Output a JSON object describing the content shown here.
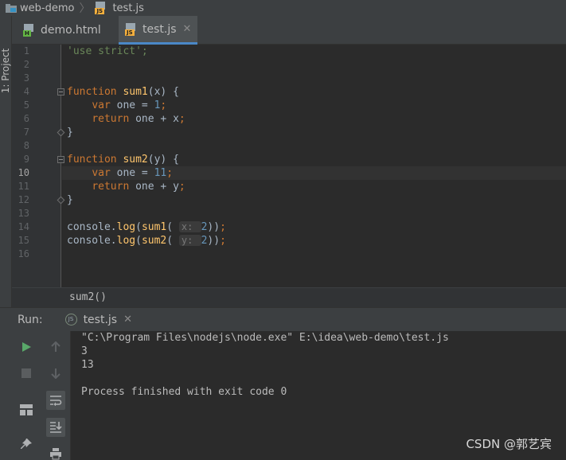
{
  "breadcrumb": {
    "project": "web-demo",
    "file": "test.js"
  },
  "left_strip": {
    "project_tab": "1: Project"
  },
  "tabs": [
    {
      "label": "demo.html",
      "badge": "H",
      "active": false
    },
    {
      "label": "test.js",
      "badge": "JS",
      "active": true
    }
  ],
  "editor": {
    "current_line": 10,
    "line_numbers": [
      "1",
      "2",
      "3",
      "4",
      "5",
      "6",
      "7",
      "8",
      "9",
      "10",
      "11",
      "12",
      "13",
      "14",
      "15",
      "16"
    ]
  },
  "code_breadcrumb": "sum2()",
  "run": {
    "label": "Run:",
    "tab_label": "test.js",
    "console": [
      "\"C:\\Program Files\\nodejs\\node.exe\" E:\\idea\\web-demo\\test.js",
      "3",
      "13",
      "",
      "Process finished with exit code 0"
    ]
  },
  "watermark": "CSDN @郭艺宾",
  "icons": {
    "run": "play-icon",
    "stop": "stop-icon",
    "up": "arrow-up-icon",
    "down": "arrow-down-icon",
    "layout": "layout-icon",
    "wrap": "soft-wrap-icon",
    "scroll": "scroll-to-end-icon",
    "pin": "pin-icon",
    "print": "print-icon"
  },
  "colors": {
    "keyword": "#cc7832",
    "string": "#6a8759",
    "number": "#6897bb",
    "function": "#ffc66d",
    "accent": "#4a88c7"
  }
}
